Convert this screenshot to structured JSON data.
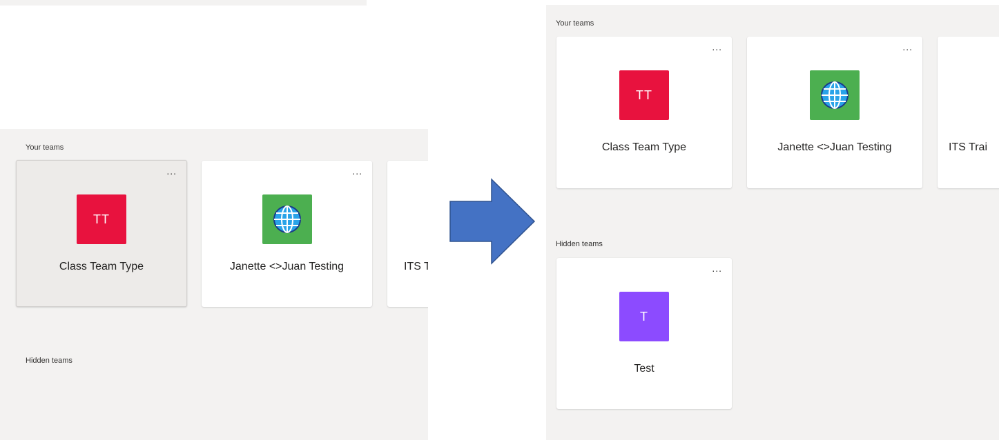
{
  "before": {
    "your_teams_label": "Your teams",
    "hidden_teams_label": "Hidden teams",
    "more_label": "...",
    "cards": [
      {
        "name": "Class Team Type",
        "initials": "TT",
        "color": "#e8123e",
        "state": "hover"
      },
      {
        "name": "Janette <>Juan Testing",
        "icon": "globe-icon",
        "color": "#4caf50"
      },
      {
        "name": "ITS T",
        "partial": true
      }
    ]
  },
  "after": {
    "your_teams_label": "Your teams",
    "hidden_teams_label": "Hidden teams",
    "more_label": "...",
    "cards": [
      {
        "name": "Class Team Type",
        "initials": "TT",
        "color": "#e8123e"
      },
      {
        "name": "Janette <>Juan Testing",
        "icon": "globe-icon",
        "color": "#4caf50"
      },
      {
        "name": "ITS Trai",
        "partial": true
      }
    ],
    "hidden_cards": [
      {
        "name": "Test",
        "initials": "T",
        "color": "#8c4bff"
      }
    ]
  },
  "arrow": {
    "icon": "right-arrow-icon",
    "color": "#4472c4",
    "stroke": "#2f528f"
  }
}
